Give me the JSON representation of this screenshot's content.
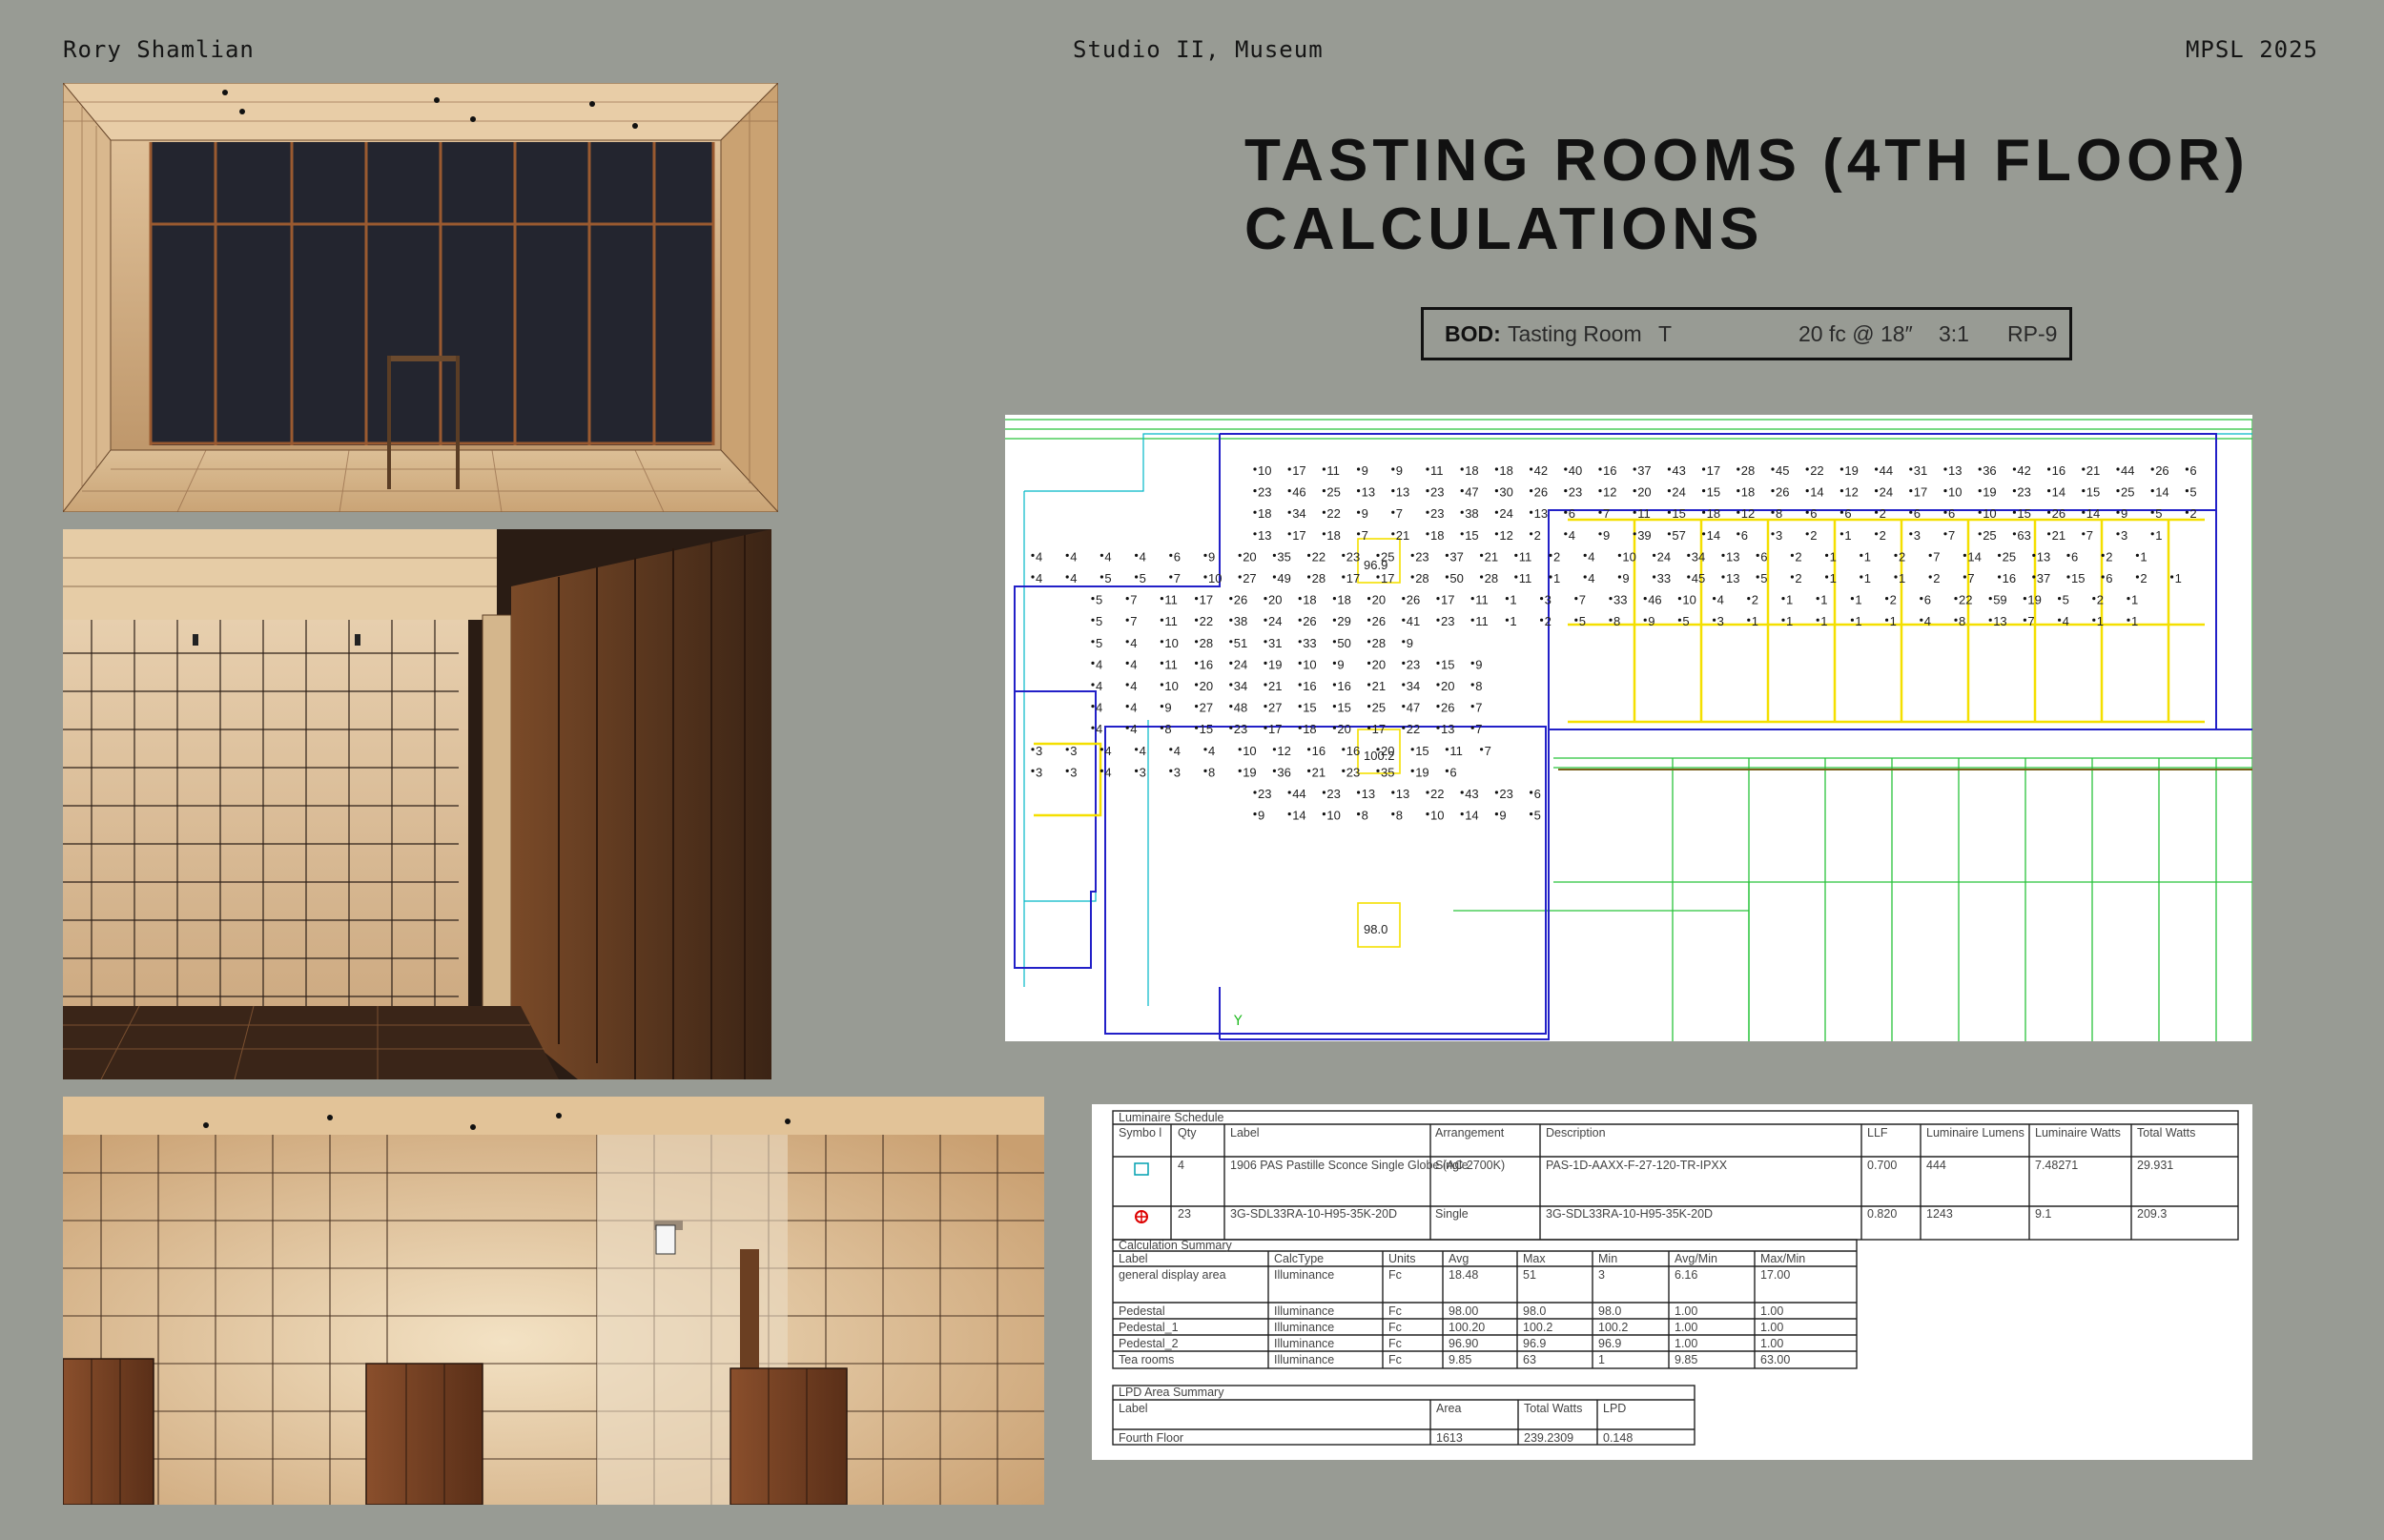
{
  "header": {
    "left": "Rory Shamlian",
    "center": "Studio II, Museum",
    "right": "MPSL 2025"
  },
  "title": {
    "line1": "TASTING ROOMS (4TH FLOOR)",
    "line2": "CALCULATIONS"
  },
  "bod": {
    "label": "BOD:",
    "room": "Tasting Room",
    "code": "T",
    "fc": "20 fc @ 18″",
    "ratio": "3:1",
    "rp": "RP-9"
  },
  "plan_pedestals": [
    "96.9",
    "100.2",
    "98.0"
  ],
  "plan_rows": [
    "10 17 11 9 9 11 18 18 42 40 16 37 43 17 28 45 22 19 44 31 13 36 42 16 21 44 26 6",
    "23 46 25 13 13 23 47 30 26 23 12 20 24 15 18 26 14 12 24 17 10 19 23 14 15 25 14 5",
    "18 34 22 9 7 23 38 24 13 6 7 11 15 18 12 8 6 6 2 6 6 10 15 26 14 9 5 2",
    "13 17 18 7 21 18 15 12 2 4 9 39 57 14 6 3 2 1 2 3 7 25 63 21 7 3 1",
    "4 4 4 4 6 9 20 35 22 23 25 23 37 21 11 2 4 10 24 34 13 6 2 1 1 2 7 14 25 13 6 2 1",
    "4 4 5 5 7 10 27 49 28 17 17 28 50 28 11 1 4 9 33 45 13 5 2 1 1 1 2 7 16 37 15 6 2 1",
    "5 7 11 17 26 20 18 18 20 26 17 11 1 3 7 33 46 10 4 2 1 1 1 2 6 22 59 19 5 2 1",
    "5 7 11 22 38 24 26 29 26 41 23 11 1 2 5 8 9 5 3 1 1 1 1 1 4 8 13 7 4 1 1",
    "5 4 10 28 51 31 33 50 28 9",
    "4 4 11 16 24 19 10 9 20 23 15 9",
    "4 4 10 20 34 21 16 16 21 34 20 8",
    "4 4 9 27 48 27 15 15 25 47 26 7",
    "4 4 8 15 23 17 18 20 17 22 13 7",
    "3 3 4 4 4 4 10 12 16 16 20 15 11 7",
    "3 3 4 3 3 8 19 36 21 23 35 19 6",
    "23 44 23 13 13 22 43 23 6",
    "9 14 10 8 8 10 14 9 5"
  ],
  "luminaire_schedule": {
    "title": "Luminaire Schedule",
    "headers": [
      "Symbo l",
      "Qty",
      "Label",
      "Arrangement",
      "Description",
      "LLF",
      "Luminaire Lumens",
      "Luminaire Watts",
      "Total Watts"
    ],
    "rows": [
      [
        "",
        "4",
        "1906 PAS Pastille Sconce Single Globe (AC 2700K)",
        "Single",
        "PAS-1D-AAXX-F-27-120-TR-IPXX",
        "0.700",
        "444",
        "7.48271",
        "29.931"
      ],
      [
        "",
        "23",
        "3G-SDL33RA-10-H95-35K-20D",
        "Single",
        "3G-SDL33RA-10-H95-35K-20D",
        "0.820",
        "1243",
        "9.1",
        "209.3"
      ]
    ]
  },
  "calculation_summary": {
    "title": "Calculation Summary",
    "headers": [
      "Label",
      "CalcType",
      "Units",
      "Avg",
      "Max",
      "Min",
      "Avg/Min",
      "Max/Min"
    ],
    "rows": [
      [
        "general display area",
        "Illuminance",
        "Fc",
        "18.48",
        "51",
        "3",
        "6.16",
        "17.00"
      ],
      [
        "Pedestal",
        "Illuminance",
        "Fc",
        "98.00",
        "98.0",
        "98.0",
        "1.00",
        "1.00"
      ],
      [
        "Pedestal_1",
        "Illuminance",
        "Fc",
        "100.20",
        "100.2",
        "100.2",
        "1.00",
        "1.00"
      ],
      [
        "Pedestal_2",
        "Illuminance",
        "Fc",
        "96.90",
        "96.9",
        "96.9",
        "1.00",
        "1.00"
      ],
      [
        "Tea rooms",
        "Illuminance",
        "Fc",
        "9.85",
        "63",
        "1",
        "9.85",
        "63.00"
      ]
    ]
  },
  "lpd_summary": {
    "title": "LPD Area Summary",
    "headers": [
      "Label",
      "Area",
      "Total Watts",
      "LPD"
    ],
    "rows": [
      [
        "Fourth Floor",
        "1613",
        "239.2309",
        "0.148"
      ]
    ]
  }
}
